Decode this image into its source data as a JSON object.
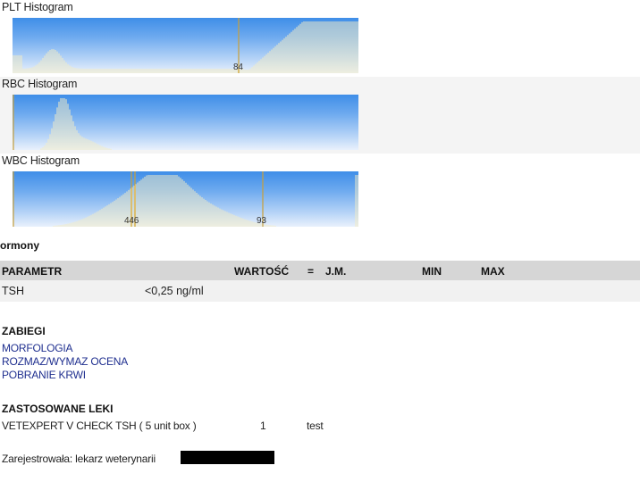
{
  "histograms": [
    {
      "title": "PLT Histogram",
      "markers": [
        {
          "label": "84"
        }
      ]
    },
    {
      "title": "RBC Histogram",
      "markers": []
    },
    {
      "title": "WBC Histogram",
      "markers": [
        {
          "label": "446"
        },
        {
          "label": "93"
        }
      ]
    }
  ],
  "hormones": {
    "title": "ormony",
    "headers": {
      "param": "PARAMETR",
      "value": "WARTOŚĆ",
      "eq": "=",
      "unit": "J.M.",
      "min": "MIN",
      "max": "MAX"
    },
    "rows": [
      {
        "param": "TSH",
        "value": "<0,25 ng/ml"
      }
    ]
  },
  "procedures": {
    "title": "ZABIEGI",
    "items": [
      "MORFOLOGIA",
      "ROZMAZ/WYMAZ OCENA",
      "POBRANIE KRWI"
    ]
  },
  "drugs": {
    "title": "ZASTOSOWANE LEKI",
    "items": [
      {
        "name": "VETEXPERT V CHECK TSH ( 5 unit box )",
        "qty": "1",
        "note": "test"
      }
    ]
  },
  "registered_by": "Zarejestrowała: lekarz weterynarii",
  "colors": {
    "bar": "#f3ecc5",
    "marker": "#c9a03a",
    "bg_top": "#3f8ee8",
    "link": "#1f2f8f"
  }
}
